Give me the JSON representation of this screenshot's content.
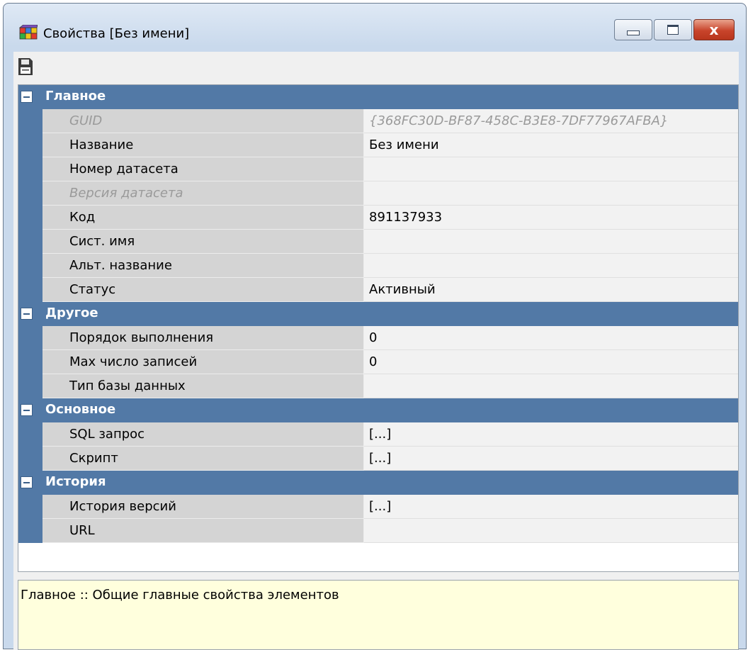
{
  "window": {
    "title": "Свойства [Без имени]",
    "close_glyph": "x"
  },
  "toolbar": {
    "save_icon": "save-icon"
  },
  "categories": [
    {
      "label": "Главное",
      "properties": [
        {
          "name": "GUID",
          "value": "{368FC30D-BF87-458C-B3E8-7DF77967AFBA}",
          "readonly": true
        },
        {
          "name": "Название",
          "value": "Без имени"
        },
        {
          "name": "Номер датасета",
          "value": ""
        },
        {
          "name": "Версия датасета",
          "value": "",
          "readonly": true
        },
        {
          "name": "Код",
          "value": "891137933"
        },
        {
          "name": "Сист. имя",
          "value": ""
        },
        {
          "name": "Альт. название",
          "value": ""
        },
        {
          "name": "Статус",
          "value": "Активный"
        }
      ]
    },
    {
      "label": "Другое",
      "properties": [
        {
          "name": "Порядок выполнения",
          "value": "0"
        },
        {
          "name": "Max число записей",
          "value": "0"
        },
        {
          "name": "Тип базы данных",
          "value": ""
        }
      ]
    },
    {
      "label": "Основное",
      "properties": [
        {
          "name": "SQL запрос",
          "value": "[...]"
        },
        {
          "name": "Скрипт",
          "value": "[...]"
        }
      ]
    },
    {
      "label": "История",
      "properties": [
        {
          "name": "История версий",
          "value": "[...]"
        },
        {
          "name": "URL",
          "value": ""
        }
      ]
    }
  ],
  "description": "Главное :: Общие главные свойства элементов",
  "colors": {
    "category_bg": "#5279a6",
    "name_cell_bg": "#d4d4d4",
    "value_cell_bg": "#f2f2f2",
    "description_bg": "#ffffdd",
    "close_button": "#c8432a"
  }
}
